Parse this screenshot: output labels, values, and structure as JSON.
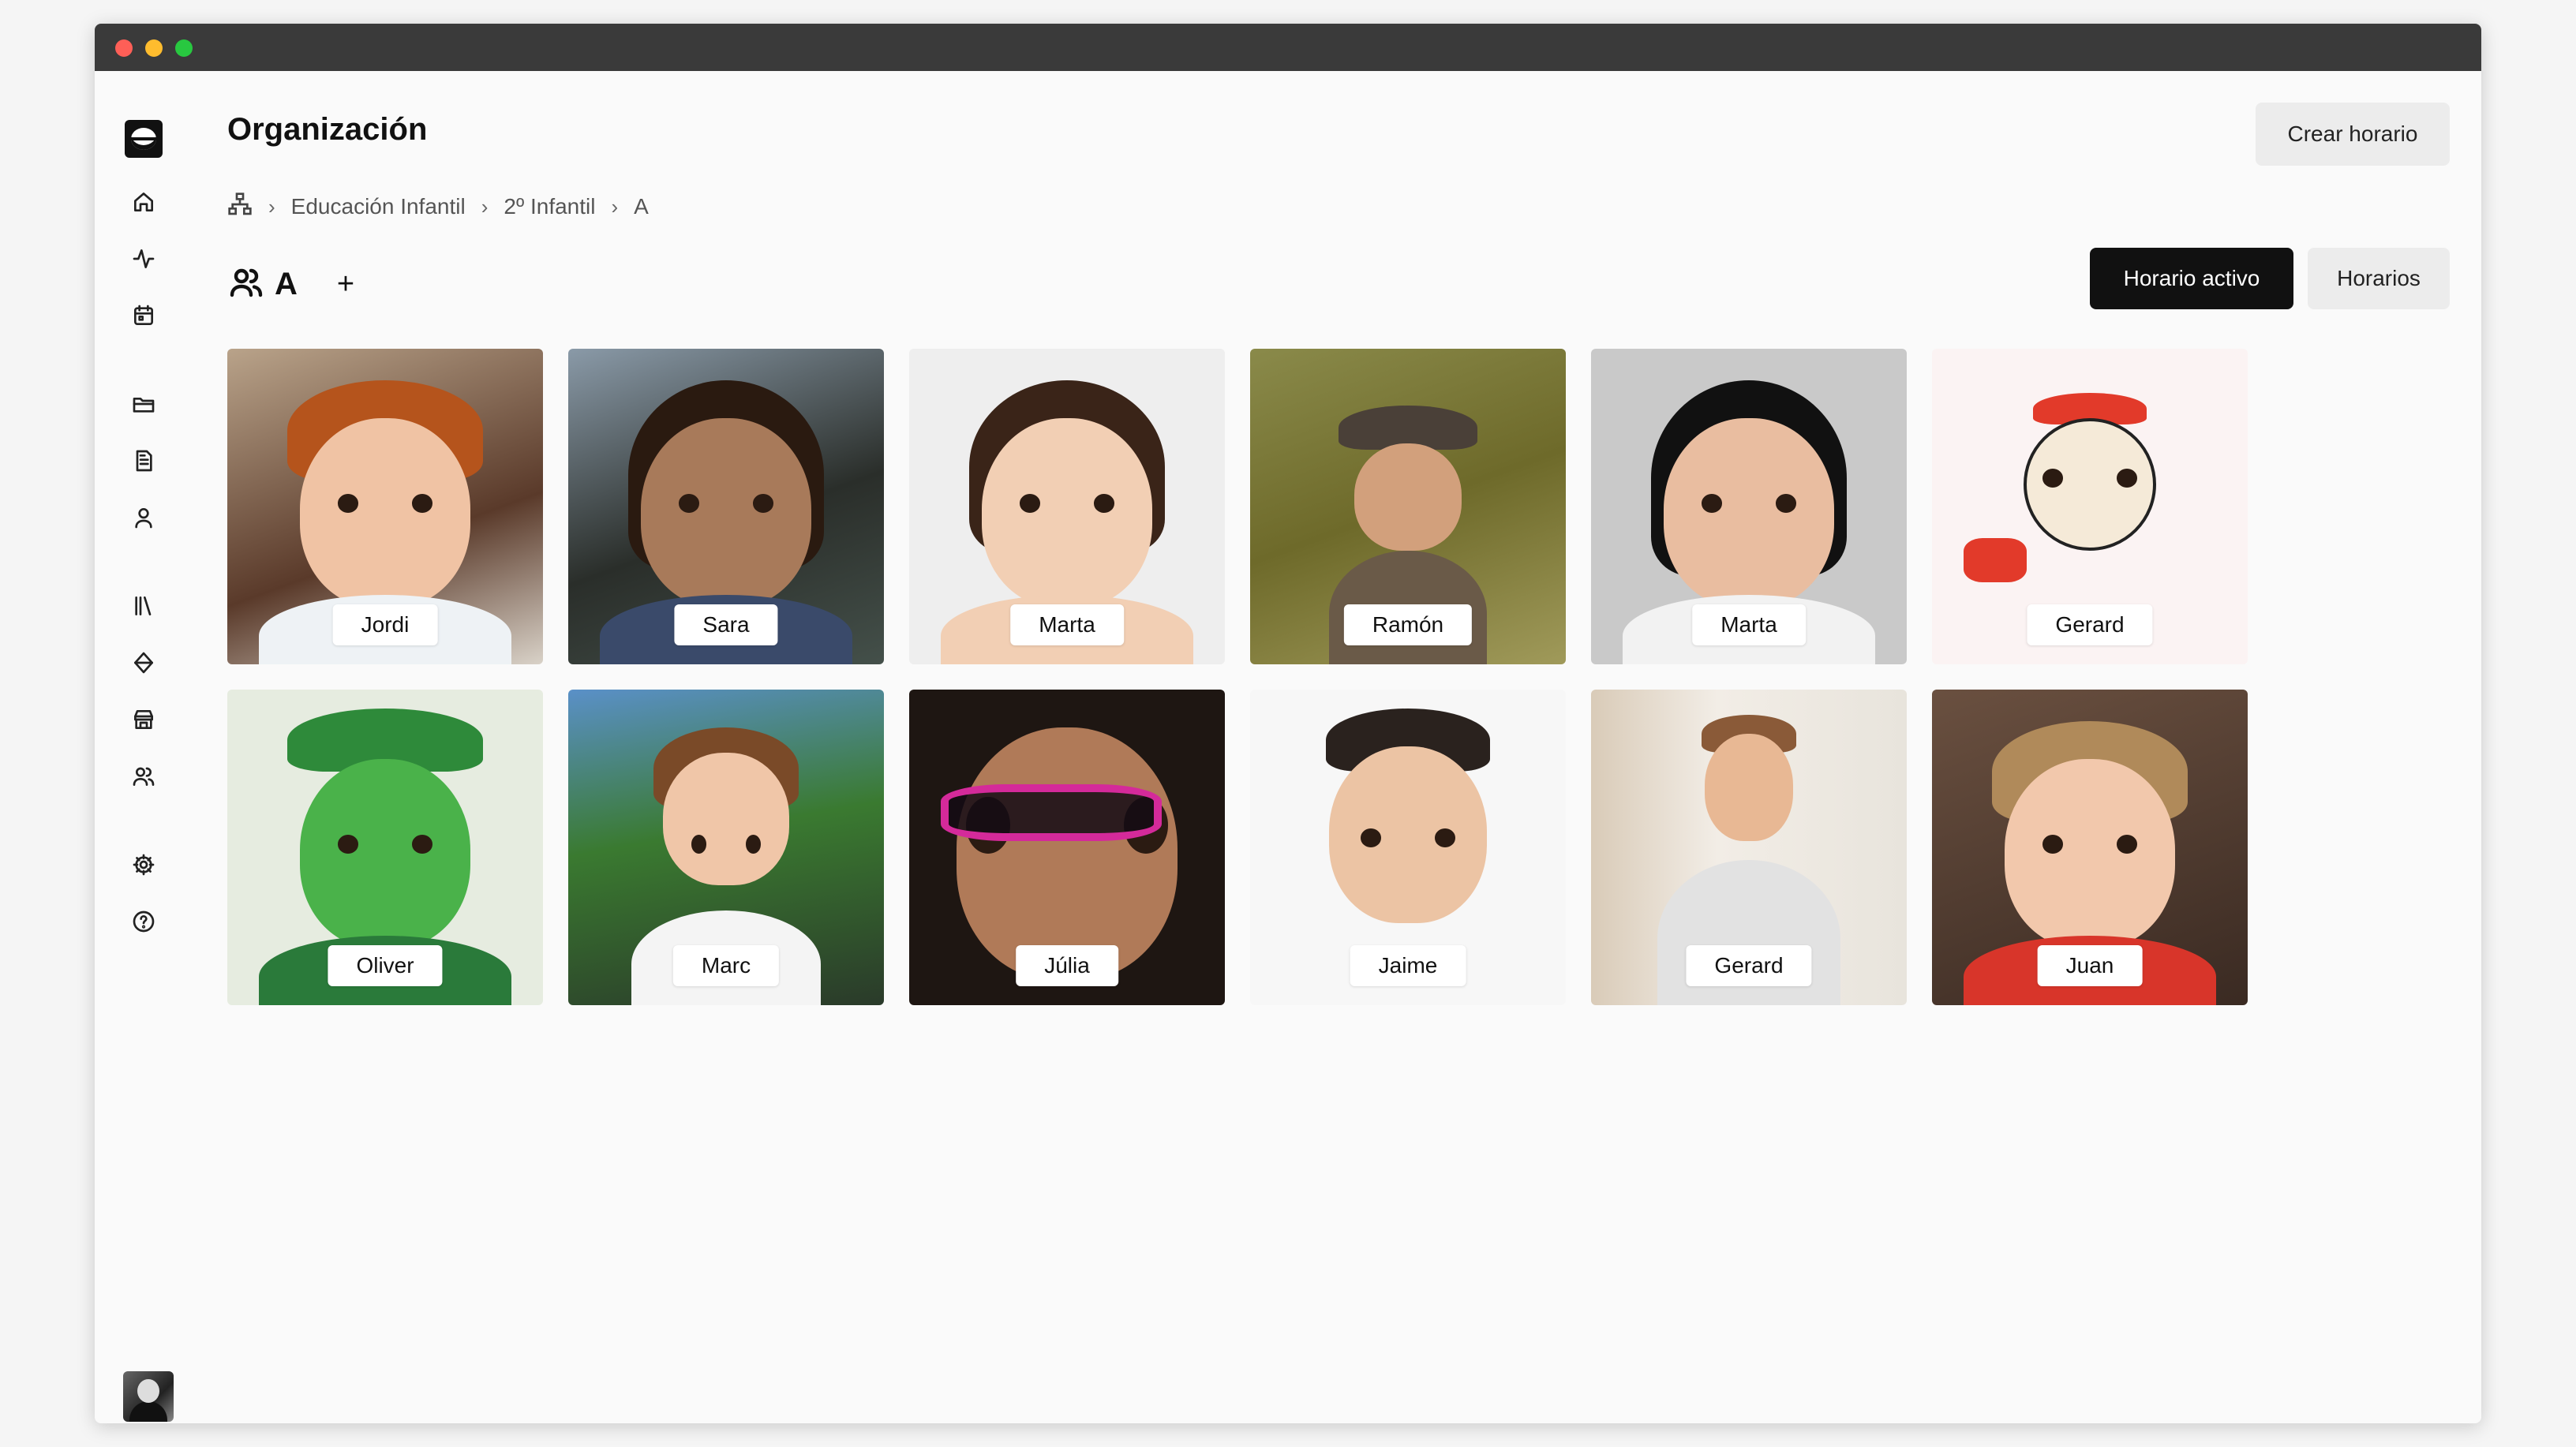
{
  "header": {
    "title": "Organización",
    "create_button": "Crear horario"
  },
  "breadcrumb": {
    "items": [
      "Educación Infantil",
      "2º Infantil",
      "A"
    ]
  },
  "group": {
    "name": "A",
    "add_label": "+",
    "active_schedule_button": "Horario activo",
    "schedules_button": "Horarios"
  },
  "sidebar": {
    "icons": [
      "home-icon",
      "activity-icon",
      "calendar-icon",
      "folder-icon",
      "document-icon",
      "user-icon",
      "library-icon",
      "layers-icon",
      "store-icon",
      "users-icon",
      "settings-icon",
      "help-icon"
    ]
  },
  "students": [
    {
      "name": "Jordi"
    },
    {
      "name": "Sara"
    },
    {
      "name": "Marta"
    },
    {
      "name": "Ramón"
    },
    {
      "name": "Marta"
    },
    {
      "name": "Gerard"
    },
    {
      "name": "Oliver"
    },
    {
      "name": "Marc"
    },
    {
      "name": "Júlia"
    },
    {
      "name": "Jaime"
    },
    {
      "name": "Gerard"
    },
    {
      "name": "Juan"
    }
  ]
}
